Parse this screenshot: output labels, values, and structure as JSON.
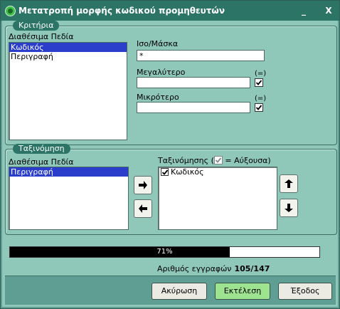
{
  "window": {
    "title": "Μετατροπή μορφής κωδικού προμηθευτών",
    "minimize": "_",
    "close": "X"
  },
  "criteria": {
    "legend": "Κριτήρια",
    "available_label": "Διαθέσιμα Πεδία",
    "available_items": [
      {
        "label": "Κωδικός",
        "selected": true
      },
      {
        "label": "Περιγραφή",
        "selected": false
      }
    ],
    "equal_mask_label": "Ισο/Μάσκα",
    "equal_mask_value": "*",
    "greater_label": "Μεγαλύτερο",
    "greater_value": "",
    "greater_eq_label": "(=)",
    "greater_eq_checked": true,
    "less_label": "Μικρότερο",
    "less_value": "",
    "less_eq_label": "(=)",
    "less_eq_checked": true
  },
  "sorting": {
    "legend": "Ταξινόμηση",
    "available_label": "Διαθέσιμα Πεδία",
    "available_items": [
      {
        "label": "Περιγραφή",
        "selected": true
      }
    ],
    "sort_label_prefix": "Ταξινόμησης (",
    "sort_label_suffix": " = Αύξουσα)",
    "sort_items": [
      {
        "label": "Κωδικός",
        "checked": true
      }
    ]
  },
  "progress": {
    "percent_text": "71%",
    "fraction": 0.71
  },
  "records": {
    "label": "Αριθμός εγγραφών",
    "value": "105/147"
  },
  "buttons": {
    "cancel": "Ακύρωση",
    "execute": "Εκτέλεση",
    "exit": "Έξοδος"
  },
  "icons": {
    "move_right": "arrow-right-icon",
    "move_left": "arrow-left-icon",
    "move_up": "arrow-up-icon",
    "move_down": "arrow-down-icon"
  }
}
